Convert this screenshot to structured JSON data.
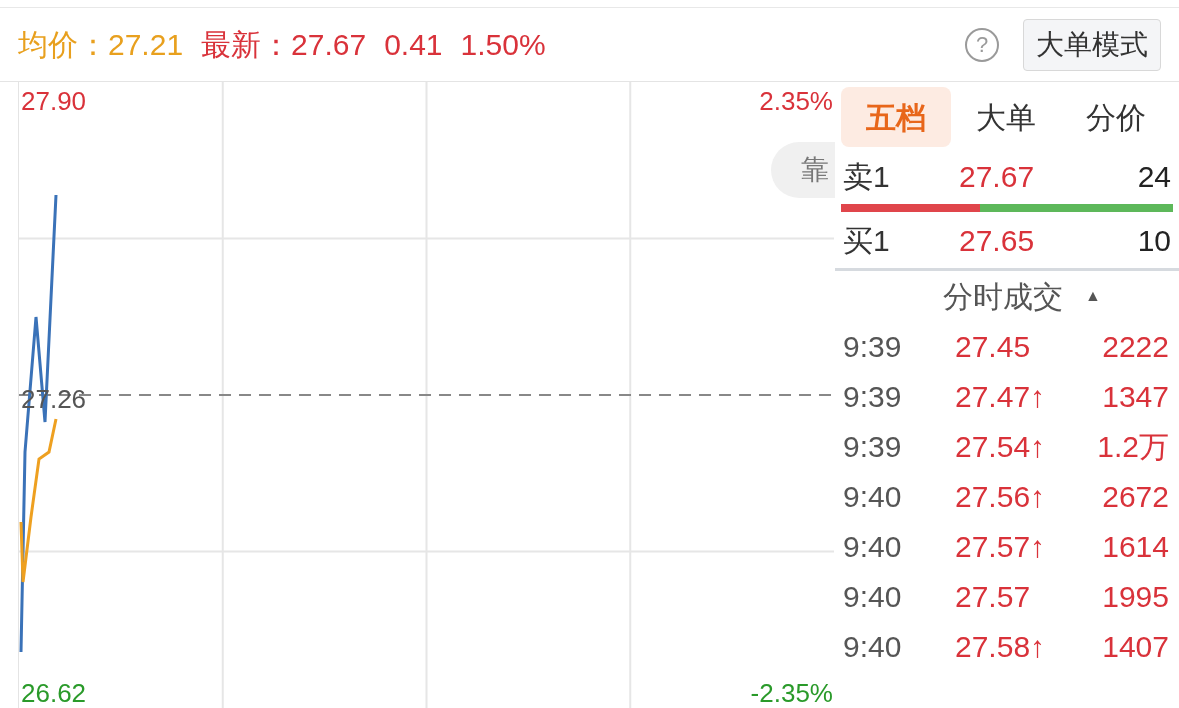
{
  "header": {
    "avg_label": "均价：",
    "avg_value": "27.21",
    "last_label": "最新：",
    "last_value": "27.67",
    "change": "0.41",
    "change_pct": "1.50%",
    "help": "?",
    "mode_button": "大单模式"
  },
  "chart": {
    "price_high": "27.90",
    "price_ref": "27.26",
    "price_low": "26.62",
    "pct_high": "2.35%",
    "pct_low": "-2.35%",
    "overlay_button": "靠"
  },
  "tabs": [
    {
      "label": "五档",
      "selected": true
    },
    {
      "label": "大单",
      "selected": false
    },
    {
      "label": "分价",
      "selected": false
    }
  ],
  "quotes": [
    {
      "label": "卖1",
      "price": "27.67",
      "volume": "24"
    },
    {
      "label": "买1",
      "price": "27.65",
      "volume": "10"
    }
  ],
  "balance": {
    "level": 0.42
  },
  "trades_header": {
    "title": "分时成交",
    "sort_icon": "▲"
  },
  "trades": [
    {
      "time": "9:39",
      "price": "27.45",
      "volume": "2222"
    },
    {
      "time": "9:39",
      "price": "27.47↑",
      "volume": "1347"
    },
    {
      "time": "9:39",
      "price": "27.54↑",
      "volume": "1.2万"
    },
    {
      "time": "9:40",
      "price": "27.56↑",
      "volume": "2672"
    },
    {
      "time": "9:40",
      "price": "27.57↑",
      "volume": "1614"
    },
    {
      "time": "9:40",
      "price": "27.57",
      "volume": "1995"
    },
    {
      "time": "9:40",
      "price": "27.58↑",
      "volume": "1407"
    }
  ]
}
